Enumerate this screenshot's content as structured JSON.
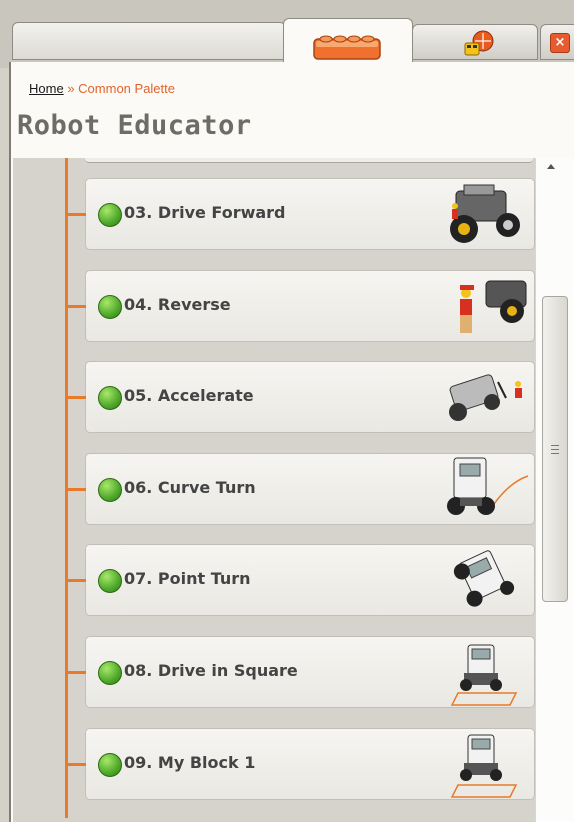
{
  "breadcrumb": {
    "home": "Home",
    "separator": "»",
    "current": "Common Palette"
  },
  "page_title": "Robot Educator",
  "tabs": [
    {
      "name": "blank-tab",
      "icon": ""
    },
    {
      "name": "lego-brick-tab",
      "icon": "lego-brick-icon"
    },
    {
      "name": "robot-head-tab",
      "icon": "robot-head-icon"
    }
  ],
  "close_label": "×",
  "lessons": [
    {
      "title": "03. Drive Forward",
      "status": "complete"
    },
    {
      "title": "04. Reverse",
      "status": "complete"
    },
    {
      "title": "05. Accelerate",
      "status": "complete"
    },
    {
      "title": "06. Curve Turn",
      "status": "complete"
    },
    {
      "title": "07. Point Turn",
      "status": "complete"
    },
    {
      "title": "08. Drive in Square",
      "status": "complete"
    },
    {
      "title": "09. My Block 1",
      "status": "complete"
    }
  ],
  "colors": {
    "accent": "#e87a2a",
    "status_complete": "#4fa82a"
  }
}
